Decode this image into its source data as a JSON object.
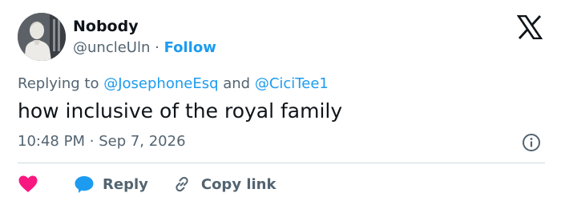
{
  "author": {
    "name": "Nobody",
    "handle": "@uncleUln",
    "separator": "·",
    "follow_label": "Follow",
    "avatar_icon": "statue-avatar"
  },
  "reply_context": {
    "prefix": "Replying to",
    "mentions": [
      "@JosephoneEsq",
      "@CiciTee1"
    ],
    "conjunction": "and"
  },
  "tweet": {
    "text": "how inclusive of the royal family",
    "time": "10:48 PM",
    "separator": "·",
    "date": "Sep 7, 2026"
  },
  "actions": {
    "like_icon": "heart-icon",
    "reply_label": "Reply",
    "copy_link_label": "Copy link"
  },
  "colors": {
    "accent": "#1d9bf0",
    "heart": "#f91880",
    "text": "#0f1419",
    "secondary": "#536471",
    "divider": "#cfd9de"
  }
}
